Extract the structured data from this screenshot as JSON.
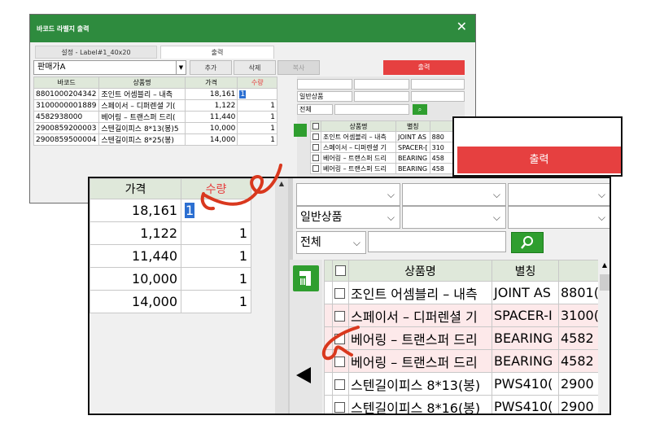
{
  "window": {
    "title": "바코드 라벨지 출력",
    "close_icon": "close-icon",
    "tabs": [
      "설정 - Label#1_40x20",
      "출력"
    ],
    "seller_select": "판매가A",
    "buttons": {
      "add": "추가",
      "delete": "삭제",
      "copy": "복사",
      "print": "출력"
    },
    "columns": [
      "바코드",
      "상품명",
      "가격",
      "수량"
    ],
    "rows": [
      {
        "barcode": "8801000204342",
        "name": "조인트 어셈블리 – 내측",
        "price": "18,161",
        "qty": "1"
      },
      {
        "barcode": "3100000001889",
        "name": "스페이서 – 디퍼렌셜 기(",
        "price": "1,122",
        "qty": "1"
      },
      {
        "barcode": "4582938000",
        "name": "베어링 – 트랜스퍼 드리(",
        "price": "11,440",
        "qty": "1"
      },
      {
        "barcode": "2900859200003",
        "name": "스텐길이피스 8*13(봉)5",
        "price": "10,000",
        "qty": "1"
      },
      {
        "barcode": "2900859500004",
        "name": "스텐길이피스 8*25(봉)",
        "price": "14,000",
        "qty": "1"
      }
    ],
    "right": {
      "category": "일반상품",
      "scope": "전체",
      "columns": [
        "상품명",
        "별칭"
      ],
      "rows": [
        {
          "name": "조인트 어셈블리 – 내측",
          "alias": "JOINT AS",
          "code": "880"
        },
        {
          "name": "스페이서 – 디퍼렌셜 기",
          "alias": "SPACER-[",
          "code": "310"
        },
        {
          "name": "베어링 – 트랜스퍼 드리",
          "alias": "BEARING",
          "code": "458"
        },
        {
          "name": "베어링 – 트랜스퍼 드리",
          "alias": "BEARING",
          "code": "458"
        }
      ]
    }
  },
  "callout": {
    "print_label": "출력"
  },
  "zoom": {
    "price_header": "가격",
    "qty_header": "수량",
    "prices": [
      "18,161",
      "1,122",
      "11,440",
      "10,000",
      "14,000"
    ],
    "qtys": [
      "1",
      "1",
      "1",
      "1",
      "1"
    ],
    "category": "일반상품",
    "scope": "전체",
    "columns": [
      "상품명",
      "별칭"
    ],
    "rows": [
      {
        "name": "조인트 어셈블리 – 내측",
        "alias": "JOINT AS",
        "code": "8801("
      },
      {
        "name": "스페이서 – 디퍼렌셜 기",
        "alias": "SPACER-I",
        "code": "3100("
      },
      {
        "name": "베어링 – 트랜스퍼 드리",
        "alias": "BEARING",
        "code": "4582"
      },
      {
        "name": "베어링 – 트랜스퍼 드리",
        "alias": "BEARING",
        "code": "4582"
      },
      {
        "name": "스텐길이피스 8*13(봉)",
        "alias": "PWS410(",
        "code": "2900"
      },
      {
        "name": "스텐길이피스 8*16(봉)",
        "alias": "PWS410(",
        "code": "2900"
      }
    ]
  },
  "colors": {
    "title_green": "#2e8b3e",
    "print_red": "#e64040",
    "header_green": "#dfe8da",
    "annotation": "#d9381e"
  }
}
